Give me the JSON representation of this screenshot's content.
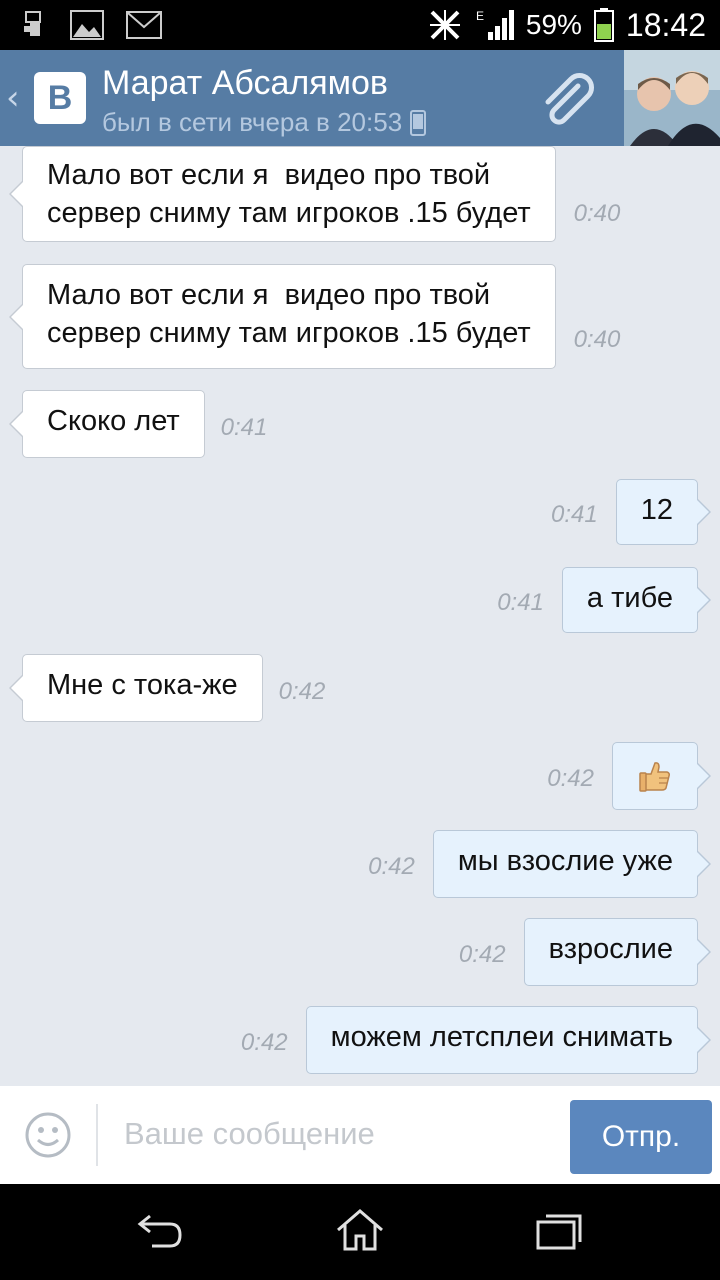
{
  "statusbar": {
    "battery_percent": "59%",
    "time": "18:42",
    "network_type": "E"
  },
  "header": {
    "app_logo": "В",
    "contact_name": "Марат Абсалямов",
    "status": "был в сети вчера в 20:53",
    "icons": [
      "back-chevron-icon",
      "paperclip-icon",
      "phone-icon"
    ]
  },
  "messages": [
    {
      "direction": "in",
      "text": "Мало вот если я  видео про твой\nсервер сниму там игроков .15 будет",
      "time": "0:40"
    },
    {
      "direction": "in",
      "text": "Мало вот если я  видео про твой\nсервер сниму там игроков .15 будет",
      "time": "0:40"
    },
    {
      "direction": "in",
      "text": "Скоко лет",
      "time": "0:41"
    },
    {
      "direction": "out",
      "text": "12",
      "time": "0:41"
    },
    {
      "direction": "out",
      "text": "а тибе",
      "time": "0:41"
    },
    {
      "direction": "in",
      "text": "Мне с тока-же",
      "time": "0:42"
    },
    {
      "direction": "out",
      "emoji": "thumbs-up",
      "time": "0:42"
    },
    {
      "direction": "out",
      "text": "мы взослие уже",
      "time": "0:42"
    },
    {
      "direction": "out",
      "text": "взрослие",
      "time": "0:42"
    },
    {
      "direction": "out",
      "text": "можем летсплеи снимать",
      "time": "0:42"
    }
  ],
  "composer": {
    "placeholder": "Ваше сообщение",
    "send_label": "Отпр."
  },
  "colors": {
    "header_bg": "#567ca4",
    "chat_bg": "#e5e9ef",
    "outgoing_bubble": "#e6f2fd",
    "send_button": "#5b87be"
  }
}
